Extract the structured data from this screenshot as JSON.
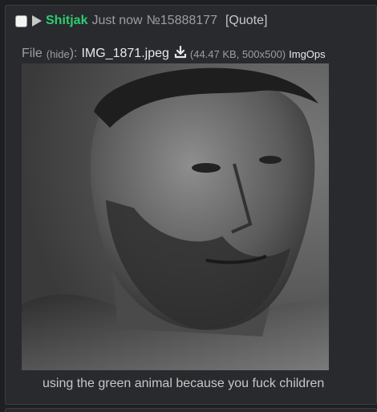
{
  "post": {
    "name": "Shitjak",
    "timestamp": "Just now",
    "post_number": "№15888177",
    "quote_label": "[Quote]",
    "comment": "using the green animal because you fuck children",
    "name_color": "#2ecc71"
  },
  "file": {
    "label": "File",
    "hide_open": "(",
    "hide_label": "hide",
    "hide_close": "):",
    "filename": "IMG_1871.jpeg",
    "download_icon": "download-icon",
    "meta": "(44.47 KB, 500x500)",
    "imgops_label": "ImgOps"
  }
}
